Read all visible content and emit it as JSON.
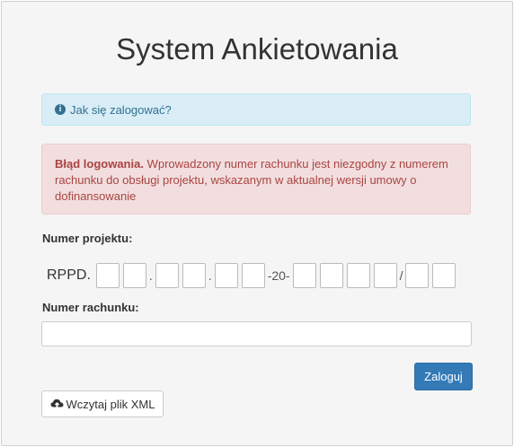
{
  "page": {
    "title": "System Ankietowania"
  },
  "info_alert": {
    "text": "Jak się zalogować?",
    "icon": "info-circle-icon"
  },
  "error_alert": {
    "title": "Błąd logowania.",
    "message": "Wprowadzony numer rachunku jest niezgodny z numerem rachunku do obsługi projektu, wskazanym w aktualnej wersji umowy o dofinansowanie"
  },
  "project": {
    "label": "Numer projektu:",
    "prefix": "RPPD.",
    "sep_dot": ".",
    "sep_dash20": "-20-",
    "sep_slash": "/"
  },
  "account": {
    "label": "Numer rachunku:",
    "value": ""
  },
  "buttons": {
    "login": "Zaloguj",
    "load_xml": "Wczytaj plik XML",
    "load_xml_icon": "cloud-upload-icon"
  },
  "colors": {
    "primary": "#337ab7",
    "info_bg": "#d9edf7",
    "info_text": "#31708f",
    "danger_bg": "#f2dede",
    "danger_text": "#a94442"
  }
}
